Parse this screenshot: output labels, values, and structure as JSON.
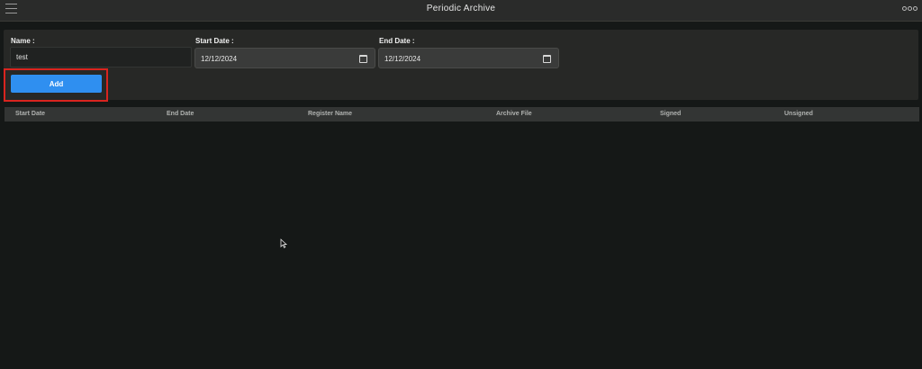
{
  "window": {
    "title": "Periodic Archive"
  },
  "form": {
    "name_label": "Name :",
    "name_value": "test",
    "start_date_label": "Start Date :",
    "start_date_value": "12/12/2024",
    "end_date_label": "End Date :",
    "end_date_value": "12/12/2024",
    "add_label": "Add"
  },
  "table": {
    "columns": [
      "Start Date",
      "End Date",
      "Register Name",
      "Archive File",
      "Signed",
      "Unsigned"
    ],
    "rows": []
  },
  "colors": {
    "accent": "#2f8ff0",
    "highlight": "#d9241f",
    "background": "#151817"
  }
}
